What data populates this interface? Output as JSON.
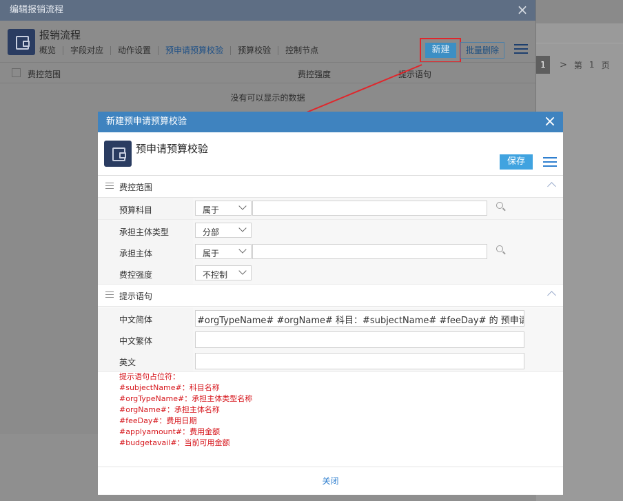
{
  "outer": {
    "title": "编辑报销流程",
    "app_title": "报销流程",
    "tabs": [
      {
        "label": "概览"
      },
      {
        "label": "字段对应"
      },
      {
        "label": "动作设置"
      },
      {
        "label": "预申请预算校验"
      },
      {
        "label": "预算校验"
      },
      {
        "label": "控制节点"
      }
    ],
    "new_label": "新建",
    "batch_delete_label": "批量删除",
    "columns": [
      "费控范围",
      "费控强度",
      "提示语句"
    ],
    "empty_text": "没有可以显示的数据"
  },
  "background_pager": {
    "page_num": "1",
    "next_symbol": ">",
    "text_1": "第",
    "text_2": "1",
    "text_3": "页"
  },
  "inner": {
    "title": "新建预申请预算校验",
    "app_title": "预申请预算校验",
    "save_label": "保存",
    "sections": {
      "scope": "费控范围",
      "message": "提示语句"
    },
    "fields": {
      "budget_subject": {
        "label": "预算科目",
        "mode": "属于",
        "value": ""
      },
      "entity_type": {
        "label": "承担主体类型",
        "value": "分部"
      },
      "entity": {
        "label": "承担主体",
        "mode": "属于",
        "value": ""
      },
      "strength": {
        "label": "费控强度",
        "value": "不控制"
      },
      "zh_cn": {
        "label": "中文简体",
        "value": "#orgTypeName# #orgName# 科目：#subjectName# #feeDay# 的 预申请流"
      },
      "zh_tw": {
        "label": "中文繁体",
        "value": ""
      },
      "en": {
        "label": "英文",
        "value": ""
      }
    },
    "hint_lines": [
      "提示语句占位符：",
      "#subjectName#：科目名称",
      "#orgTypeName#：承担主体类型名称",
      "#orgName#：承担主体名称",
      "#feeDay#：费用日期",
      "#applyamount#：费用金额",
      "#budgetavail#：当前可用金额"
    ],
    "close_label": "关闭"
  },
  "colors": {
    "inner_title_bar": "#3f83bf",
    "highlight": "#e0262b",
    "hint_text": "#d6151b",
    "save_button": "#40a3e0"
  }
}
